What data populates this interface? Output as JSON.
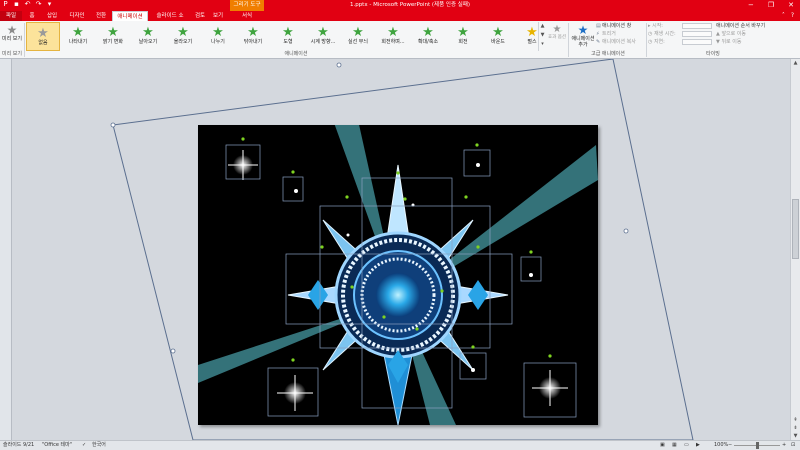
{
  "titlebar": {
    "context_tab": "그리기 도구",
    "title": "1.pptx - Microsoft PowerPoint (제품 인증 실패)",
    "qat_icons": [
      "save-icon",
      "undo-icon",
      "redo-icon",
      "customize-icon"
    ],
    "window_buttons": [
      "−",
      "❐",
      "✕"
    ]
  },
  "tabs": [
    {
      "label": "파일",
      "kind": "file"
    },
    {
      "label": "홈"
    },
    {
      "label": "삽입"
    },
    {
      "label": "디자인"
    },
    {
      "label": "전환"
    },
    {
      "label": "애니메이션",
      "kind": "active"
    },
    {
      "label": "슬라이드 쇼"
    },
    {
      "label": "검토"
    },
    {
      "label": "보기"
    },
    {
      "label": "서식"
    }
  ],
  "ribbon": {
    "preview": {
      "label": "미리 보기"
    },
    "preview_group_label": "미리 보기",
    "animations": [
      {
        "label": "없음",
        "kind": "none"
      },
      {
        "label": "나타내기"
      },
      {
        "label": "밝기 변화"
      },
      {
        "label": "날아오기"
      },
      {
        "label": "올라오기"
      },
      {
        "label": "나누기"
      },
      {
        "label": "닦아내기"
      },
      {
        "label": "도형"
      },
      {
        "label": "시계 방향..."
      },
      {
        "label": "실선 무늬"
      },
      {
        "label": "회전하며..."
      },
      {
        "label": "확대/축소"
      },
      {
        "label": "회전"
      },
      {
        "label": "바운드"
      },
      {
        "label": "펄스"
      }
    ],
    "effect_options": "효과 옵션",
    "animation_group_label": "애니메이션",
    "add_animation": "애니메이션 추가",
    "advanced": [
      "애니메이션 창",
      "트리거",
      "애니메이션 복사"
    ],
    "advanced_group_label": "고급 애니메이션",
    "timing": [
      "시작:",
      "재생 시간:",
      "지연:"
    ],
    "reorder": [
      "애니메이션 순서 바꾸기",
      "앞으로 이동",
      "뒤로 이동"
    ],
    "timing_group_label": "타이밍"
  },
  "statusbar": {
    "slide": "슬라이드 9/21",
    "theme": "\"Office 테마\"",
    "language": "한국어",
    "zoom": "100%"
  },
  "colors": {
    "brand_red": "#e10012",
    "context_orange": "#f07e00",
    "selection_outline": "#5b6f8f",
    "handle_green": "#7ed321",
    "beam_cyan": "#5ed0dd"
  }
}
